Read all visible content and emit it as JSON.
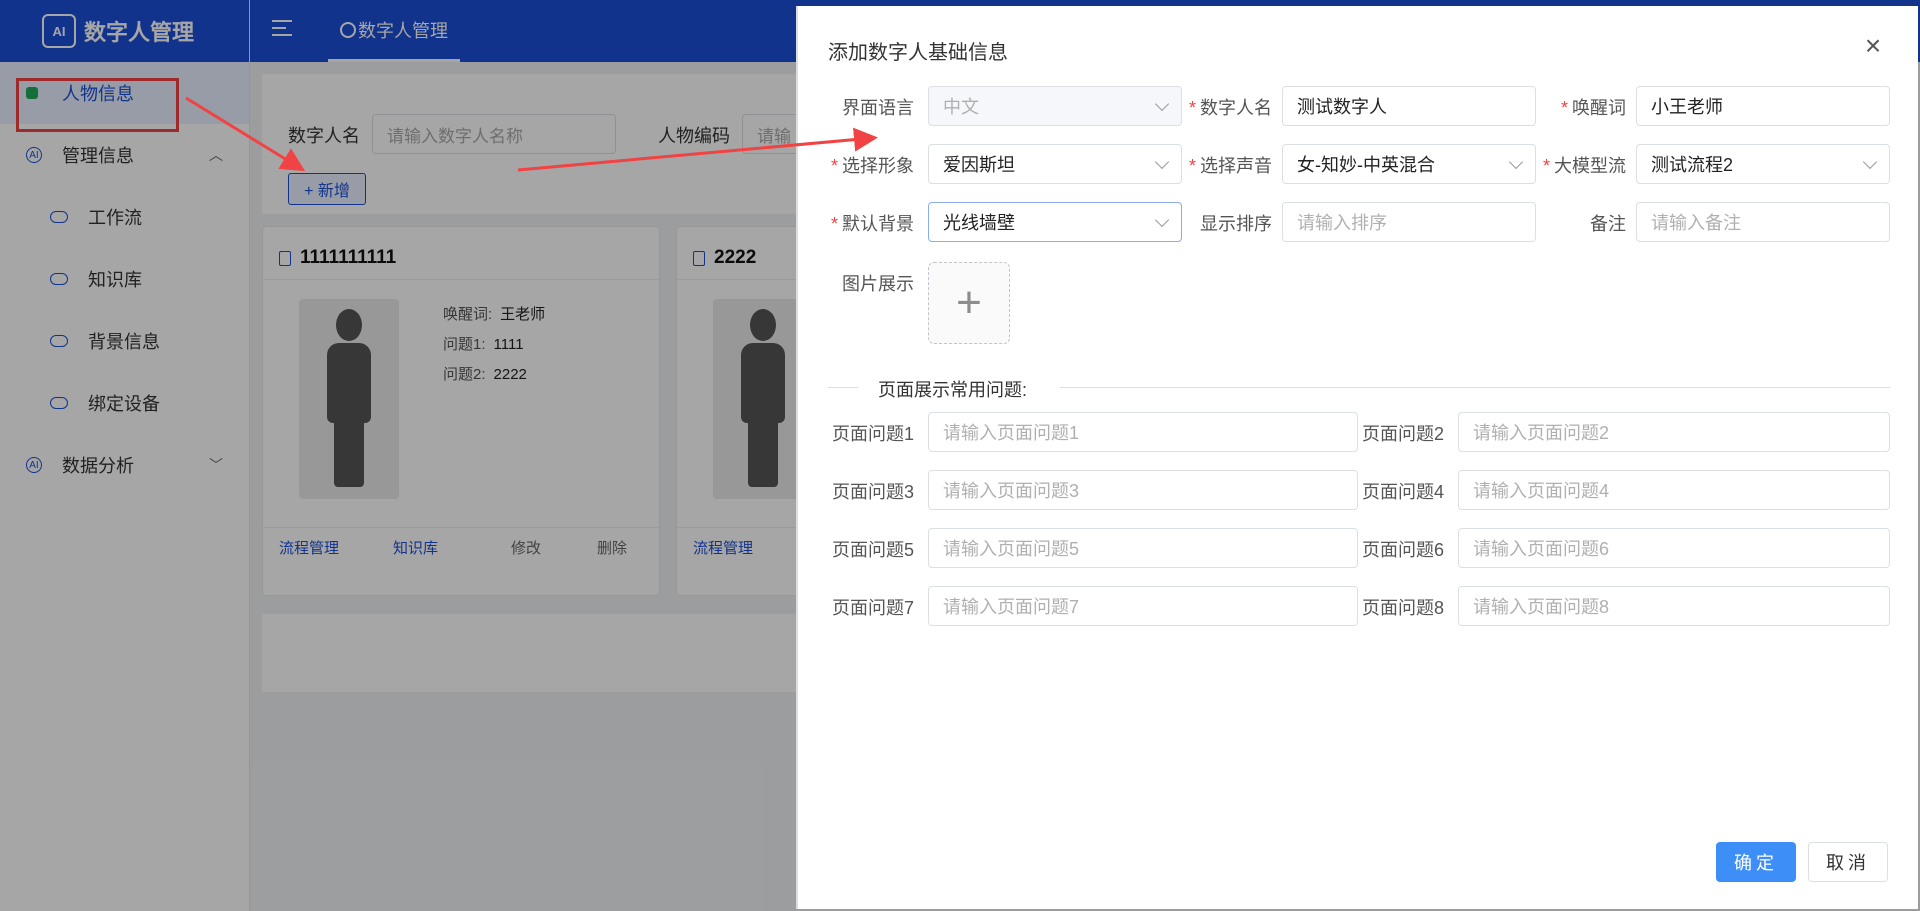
{
  "app": {
    "title": "数字人管理",
    "logo_text": "AI"
  },
  "sidebar": {
    "items": [
      {
        "label": "人物信息",
        "active": true
      },
      {
        "label": "管理信息",
        "expanded": true
      },
      {
        "label": "工作流"
      },
      {
        "label": "知识库"
      },
      {
        "label": "背景信息"
      },
      {
        "label": "绑定设备"
      },
      {
        "label": "数据分析",
        "expanded": false
      }
    ]
  },
  "topbar": {
    "tab_label": "数字人管理"
  },
  "search": {
    "name_label": "数字人名",
    "name_placeholder": "请输入数字人名称",
    "code_label": "人物编码",
    "code_placeholder": "请输",
    "add_button": "+ 新增"
  },
  "cards": [
    {
      "title": "1111111111",
      "wake_label": "唤醒词:",
      "wake_value": "王老师",
      "q1_label": "问题1:",
      "q1_value": "1111",
      "q2_label": "问题2:",
      "q2_value": "2222",
      "actions": [
        "流程管理",
        "知识库",
        "修改",
        "删除"
      ]
    },
    {
      "title": "2222",
      "actions": [
        "流程管理"
      ]
    }
  ],
  "dialog": {
    "title": "添加数字人基础信息",
    "fields": {
      "ui_language": {
        "label": "界面语言",
        "value": "中文"
      },
      "name": {
        "label": "数字人名",
        "value": "测试数字人",
        "required": true
      },
      "wake_word": {
        "label": "唤醒词",
        "value": "小王老师",
        "required": true
      },
      "figure": {
        "label": "选择形象",
        "value": "爱因斯坦",
        "required": true
      },
      "voice": {
        "label": "选择声音",
        "value": "女-知妙-中英混合",
        "required": true
      },
      "llm_flow": {
        "label": "大模型流",
        "value": "测试流程2",
        "required": true
      },
      "background": {
        "label": "默认背景",
        "value": "光线墙壁",
        "required": true
      },
      "sort": {
        "label": "显示排序",
        "placeholder": "请输入排序"
      },
      "remark": {
        "label": "备注",
        "placeholder": "请输入备注"
      },
      "image": {
        "label": "图片展示"
      }
    },
    "questions_section": "页面展示常用问题:",
    "questions": [
      {
        "label": "页面问题1",
        "placeholder": "请输入页面问题1"
      },
      {
        "label": "页面问题2",
        "placeholder": "请输入页面问题2"
      },
      {
        "label": "页面问题3",
        "placeholder": "请输入页面问题3"
      },
      {
        "label": "页面问题4",
        "placeholder": "请输入页面问题4"
      },
      {
        "label": "页面问题5",
        "placeholder": "请输入页面问题5"
      },
      {
        "label": "页面问题6",
        "placeholder": "请输入页面问题6"
      },
      {
        "label": "页面问题7",
        "placeholder": "请输入页面问题7"
      },
      {
        "label": "页面问题8",
        "placeholder": "请输入页面问题8"
      }
    ],
    "confirm": "确定",
    "cancel": "取消"
  },
  "colors": {
    "brand": "#1c4fd8",
    "primary_button": "#3d8ef7",
    "required": "#f14343",
    "annotation": "#f14343"
  }
}
